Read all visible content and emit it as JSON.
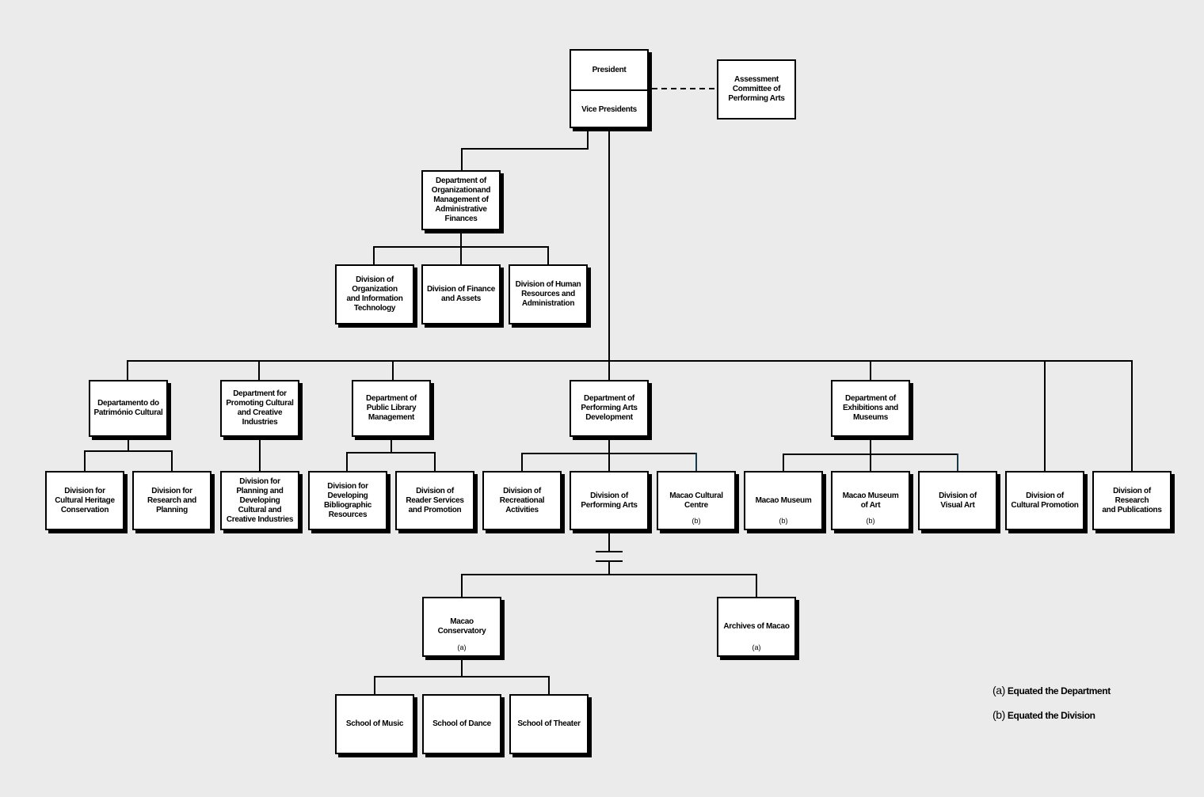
{
  "chart": {
    "president": "President",
    "vice_presidents": "Vice Presidents",
    "assessment_committee": "Assessment\nCommittee of\nPerforming Arts",
    "admin_finance_dept": "Department of\nOrganizationand\nManagement of\nAdministrative\nFinances",
    "admin_divisions": [
      "Division of\nOrganization\nand Information\nTechnology",
      "Division of Finance\nand Assets",
      "Division of Human\nResources and\nAdministration"
    ],
    "departments": [
      {
        "name": "Departamento do\nPatrimónio Cultural",
        "children": [
          {
            "name": "Division for\nCultural Heritage\nConservation",
            "note": ""
          },
          {
            "name": "Division for\nResearch and\nPlanning",
            "note": ""
          }
        ]
      },
      {
        "name": "Department for\nPromoting Cultural\nand Creative\nIndustries",
        "children": [
          {
            "name": "Division for\nPlanning and\nDeveloping\nCultural and\nCreative Industries",
            "note": ""
          }
        ]
      },
      {
        "name": "Department of\nPublic Library\nManagement",
        "children": [
          {
            "name": "Division for\nDeveloping\nBibliographic\nResources",
            "note": ""
          },
          {
            "name": "Division of\nReader Services\nand Promotion",
            "note": ""
          }
        ]
      },
      {
        "name": "Department of\nPerforming Arts\nDevelopment",
        "children": [
          {
            "name": "Division of\nRecreational\nActivities",
            "note": ""
          },
          {
            "name": "Division of\nPerforming Arts",
            "note": ""
          },
          {
            "name": "Macao Cultural\nCentre",
            "note": "(b)"
          }
        ]
      },
      {
        "name": "Department of\nExhibitions and\nMuseums",
        "children": [
          {
            "name": "Macao Museum",
            "note": "(b)"
          },
          {
            "name": "Macao Museum\nof Art",
            "note": "(b)"
          },
          {
            "name": "Division of\nVisual Art",
            "note": ""
          }
        ]
      }
    ],
    "direct_divisions": [
      "Division of\nCultural Promotion",
      "Division of Research\nand Publications"
    ],
    "equated_units": [
      {
        "name": "Macao Conservatory",
        "note": "(a)"
      },
      {
        "name": "Archives of Macao",
        "note": "(a)"
      }
    ],
    "schools": [
      "School of Music",
      "School of Dance",
      "School of Theater"
    ]
  },
  "legend": [
    {
      "mark": "(a)",
      "text": "Equated the Department"
    },
    {
      "mark": "(b)",
      "text": "Equated the Division"
    }
  ]
}
